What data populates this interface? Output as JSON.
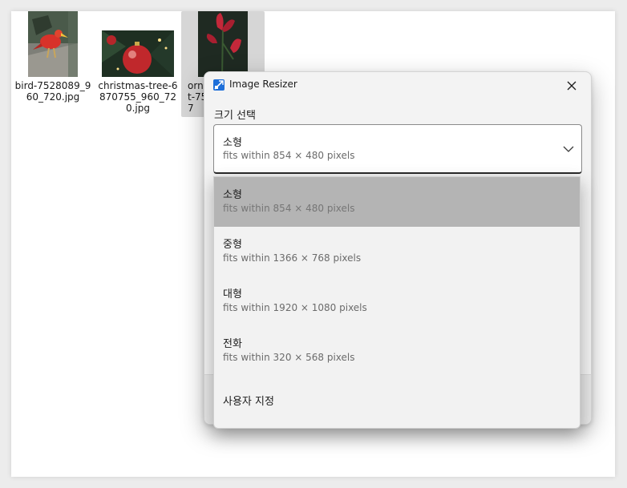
{
  "files": [
    {
      "name": "bird-7528089_960_720.jpg",
      "thumb": "bird-photo"
    },
    {
      "name": "christmas-tree-6870755_960_720.jpg",
      "thumb": "christmas-ornament-photo"
    },
    {
      "name": "ornament-7...",
      "visible_fragments": [
        "orna",
        "t-75",
        "7"
      ],
      "thumb": "red-flower-photo"
    }
  ],
  "dialog": {
    "title": "Image Resizer",
    "size_label": "크기 선택",
    "selected": {
      "name": "소형",
      "desc": "fits within 854 × 480 pixels"
    }
  },
  "dropdown": {
    "items": [
      {
        "name": "소형",
        "desc": "fits within 854 × 480 pixels",
        "selected": true
      },
      {
        "name": "중형",
        "desc": "fits within 1366 × 768 pixels",
        "selected": false
      },
      {
        "name": "대형",
        "desc": "fits within 1920 × 1080 pixels",
        "selected": false
      },
      {
        "name": "전화",
        "desc": "fits within 320 × 568 pixels",
        "selected": false
      },
      {
        "name": "사용자 지정",
        "desc": "",
        "selected": false
      }
    ]
  },
  "icons": {
    "app": "image-resizer-icon",
    "close": "close-icon",
    "chevron": "chevron-down-icon"
  },
  "colors": {
    "selected_item": "#b4b4b4",
    "app_icon_blue": "#1e6fd9"
  }
}
